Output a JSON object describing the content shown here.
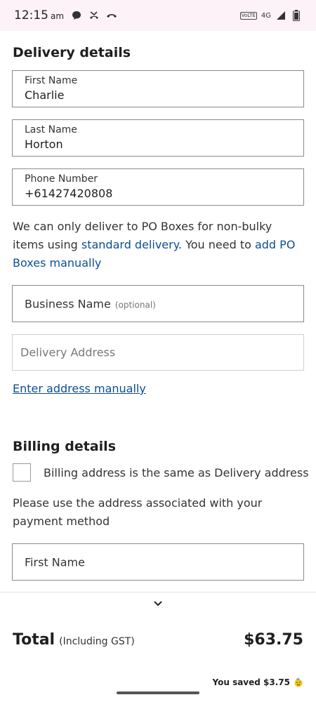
{
  "status_bar": {
    "time": "12:15",
    "ampm": "am",
    "network": "4G",
    "volte": "VoLTE",
    "left_icons": [
      "chat-bubble-icon",
      "missed-call-icon",
      "call-icon"
    ],
    "right_icons": [
      "volte-icon",
      "signal-icon",
      "battery-icon"
    ]
  },
  "delivery": {
    "title": "Delivery details",
    "first_name": {
      "label": "First Name",
      "value": "Charlie"
    },
    "last_name": {
      "label": "Last Name",
      "value": "Horton"
    },
    "phone": {
      "label": "Phone Number",
      "value": "+61427420808"
    },
    "po_box_notice": {
      "text_1": "We can only deliver to PO Boxes for non-bulky items using ",
      "link_1": "standard delivery",
      "text_2": ". You need to ",
      "link_2": "add PO Boxes manually"
    },
    "business_name": {
      "label": "Business Name",
      "optional": "(optional)"
    },
    "address": {
      "placeholder": "Delivery Address"
    },
    "manual_link": "Enter address manually"
  },
  "billing": {
    "title": "Billing details",
    "same_as_delivery_label": "Billing address is the same as Delivery address",
    "same_as_delivery_checked": false,
    "notice": "Please use the address associated with your payment method",
    "first_name": {
      "label": "First Name"
    }
  },
  "summary": {
    "total_label": "Total",
    "gst_label": "(Including GST)",
    "total_amount": "$63.75",
    "saved_text": "You saved $3.75",
    "saved_icon": "party-icon"
  }
}
